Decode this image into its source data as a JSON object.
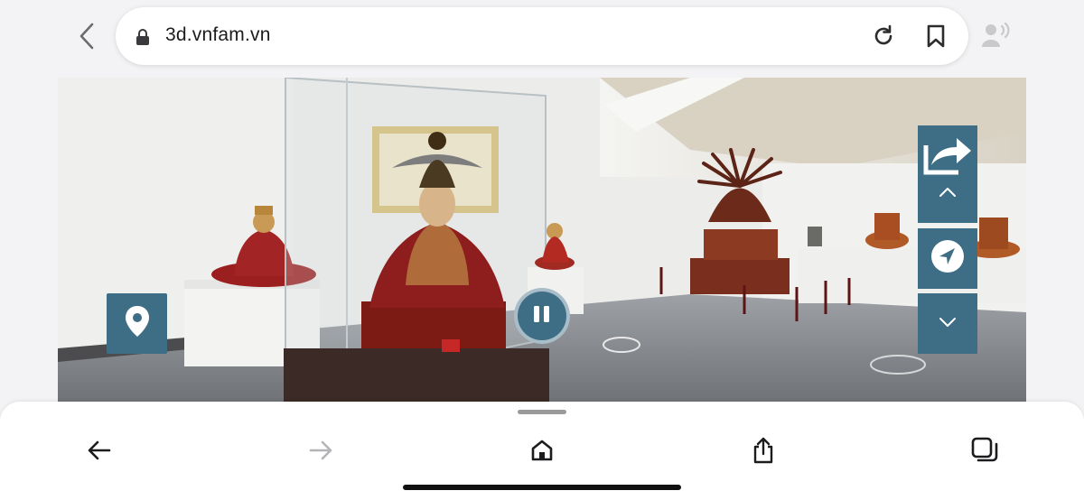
{
  "browser": {
    "url": "3d.vnfam.vn",
    "icons": [
      "back-chevron-icon",
      "lock-icon",
      "reload-icon",
      "bookmark-icon",
      "voice-icon"
    ]
  },
  "tour": {
    "controls": [
      "location-pin-icon",
      "pause-icon",
      "share-icon",
      "chevron-up-icon",
      "navigation-arrow-icon",
      "chevron-down-icon"
    ],
    "accent_color": "#3e6d86"
  },
  "toolbar": {
    "icons": [
      "arrow-left-icon",
      "arrow-right-icon",
      "home-icon",
      "share-icon",
      "tabs-icon"
    ]
  }
}
